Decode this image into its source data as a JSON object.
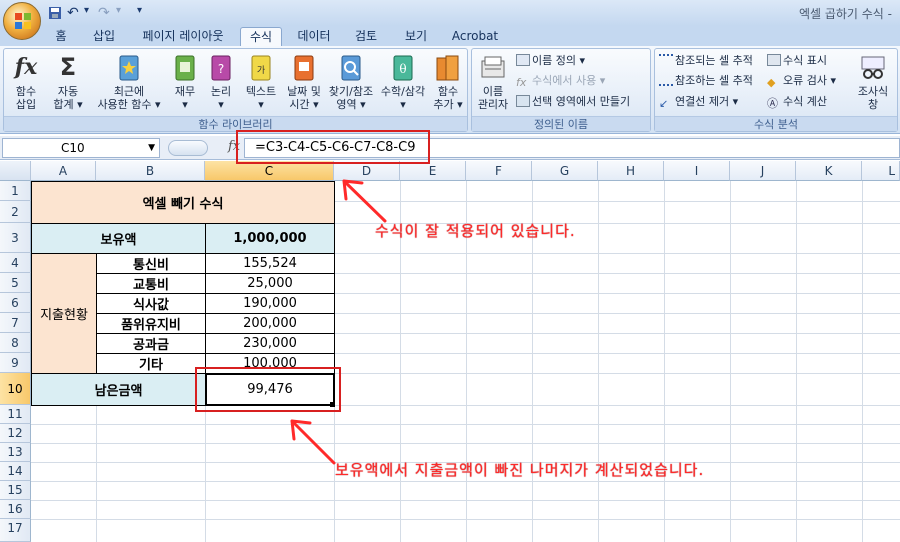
{
  "window": {
    "title": "엑셀 곱하기 수식 -"
  },
  "qat": {
    "undo_glyph": "↶",
    "redo_glyph": "↷",
    "dropdown_glyph": "▾"
  },
  "tabs": [
    "홈",
    "삽입",
    "페이지 레이아웃",
    "수식",
    "데이터",
    "검토",
    "보기",
    "Acrobat"
  ],
  "ribbon": {
    "function_library": {
      "label": "함수 라이브러리",
      "insert_function": [
        "함수",
        "삽입"
      ],
      "autosum": [
        "자동",
        "합계 ▾"
      ],
      "recent": [
        "최근에",
        "사용한 함수 ▾"
      ],
      "financial": [
        "재무",
        "▾"
      ],
      "logical": [
        "논리",
        "▾"
      ],
      "text": [
        "텍스트",
        "▾"
      ],
      "datetime": [
        "날짜 및",
        "시간 ▾"
      ],
      "lookup": [
        "찾기/참조",
        "영역 ▾"
      ],
      "math": [
        "수학/삼각",
        "▾"
      ],
      "more": [
        "함수",
        "추가 ▾"
      ]
    },
    "defined_names": {
      "label": "정의된 이름",
      "name_manager": [
        "이름",
        "관리자"
      ],
      "define_name": "이름 정의 ▾",
      "use_in_formula": "수식에서 사용 ▾",
      "create_from_selection": "선택 영역에서 만들기"
    },
    "formula_auditing": {
      "label": "수식 분석",
      "trace_precedents": "참조되는 셀 추적",
      "trace_dependents": "참조하는 셀 추적",
      "remove_arrows": "연결선 제거 ▾",
      "show_formulas": "수식 표시",
      "error_checking": "오류 검사 ▾",
      "evaluate_formula": "수식 계산",
      "watch_window": [
        "조사식",
        "창"
      ]
    }
  },
  "formula_bar": {
    "name_box": "C10",
    "fx": "fx",
    "formula": "=C3-C4-C5-C6-C7-C8-C9"
  },
  "columns": [
    "A",
    "B",
    "C",
    "D",
    "E",
    "F",
    "G",
    "H",
    "I",
    "J",
    "K",
    "L"
  ],
  "rows": [
    "1",
    "2",
    "3",
    "4",
    "5",
    "6",
    "7",
    "8",
    "9",
    "10",
    "11",
    "12",
    "13",
    "14",
    "15",
    "16",
    "17"
  ],
  "sheet": {
    "title": "엑셀 빼기 수식",
    "holdings_label": "보유액",
    "holdings_value": "1,000,000",
    "expense_group": "지출현황",
    "expenses": [
      {
        "label": "통신비",
        "value": "155,524"
      },
      {
        "label": "교통비",
        "value": "25,000"
      },
      {
        "label": "식사값",
        "value": "190,000"
      },
      {
        "label": "품위유지비",
        "value": "200,000"
      },
      {
        "label": "공과금",
        "value": "230,000"
      },
      {
        "label": "기타",
        "value": "100,000"
      }
    ],
    "remaining_label": "남은금액",
    "remaining_value": "99,476"
  },
  "annotations": {
    "top": "수식이 잘 적용되어 있습니다.",
    "bottom": "보유액에서 지출금액이 빠진 나머지가 계산되었습니다."
  },
  "colors": {
    "accent": "#d82020",
    "header_peach": "#fce4d0",
    "header_blue": "#daeef3"
  }
}
